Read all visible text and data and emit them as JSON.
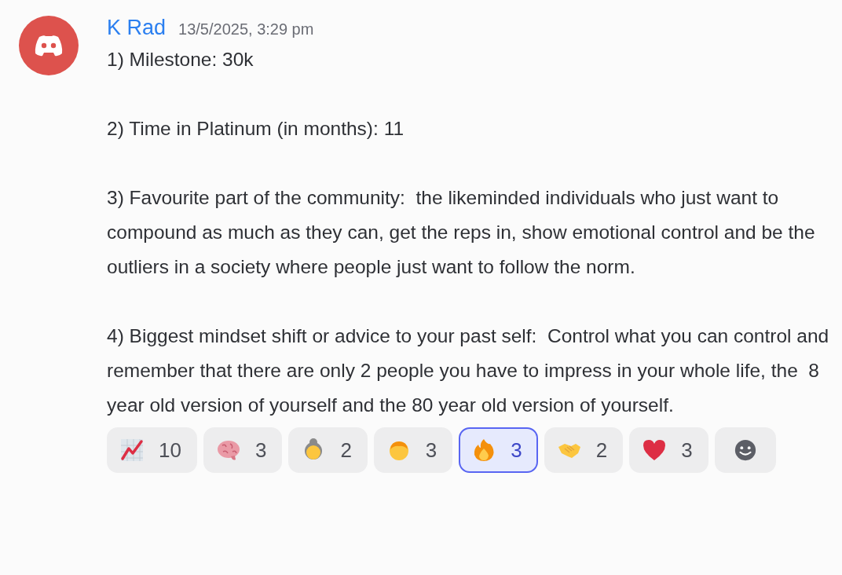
{
  "message": {
    "author": "K Rad",
    "timestamp": "13/5/2025, 3:29 pm",
    "paragraphs": [
      "1) Milestone: 30k",
      "2) Time in Platinum (in months): 11",
      "3) Favourite part of the community:  the likeminded individuals who just want to compound as much as they can, get the reps in, show emotional control and be the outliers in a society where people just want to follow the norm.",
      "4) Biggest mindset shift or advice to your past self:  Control what you can control and remember that there are only 2 people you have to impress in your whole life, the  8 year old version of yourself and the 80 year old version of yourself."
    ],
    "reactions": [
      {
        "kind": "chart",
        "count": "10",
        "selected": false
      },
      {
        "kind": "brain",
        "count": "3",
        "selected": false
      },
      {
        "kind": "older-woman",
        "count": "2",
        "selected": false
      },
      {
        "kind": "child",
        "count": "3",
        "selected": false
      },
      {
        "kind": "fire",
        "count": "3",
        "selected": true
      },
      {
        "kind": "handshake",
        "count": "2",
        "selected": false
      },
      {
        "kind": "heart",
        "count": "3",
        "selected": false
      }
    ]
  }
}
